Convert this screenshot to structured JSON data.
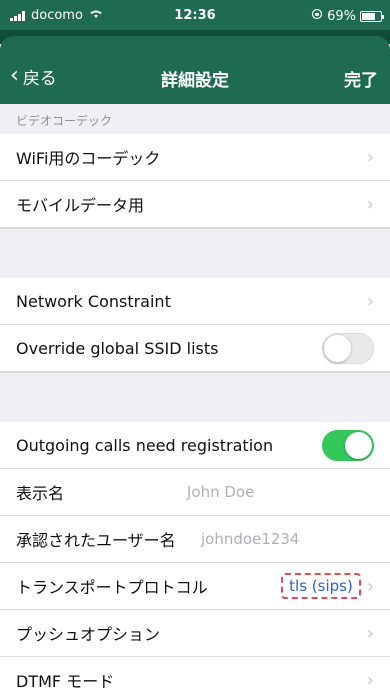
{
  "statusbar": {
    "carrier": "docomo",
    "time": "12:36",
    "battery": "69%"
  },
  "navbar": {
    "back_label": "戻る",
    "title": "詳細設定",
    "done_label": "完了"
  },
  "sections": {
    "video_codec_header": "ビデオコーデック",
    "wifi_codec": "WiFi用のコーデック",
    "mobile_data": "モバイルデータ用",
    "network_constraint": "Network Constraint",
    "override_ssid": "Override global SSID lists",
    "override_ssid_enabled": false,
    "outgoing_registration": "Outgoing calls need registration",
    "outgoing_registration_enabled": true,
    "display_name_label": "表示名",
    "display_name_placeholder": "John Doe",
    "auth_username_label": "承認されたユーザー名",
    "auth_username_placeholder": "johndoe1234",
    "transport_label": "トランスポートプロトコル",
    "transport_value": "tls (sips)",
    "push_options": "プッシュオプション",
    "dtmf_mode": "DTMF モード"
  },
  "colors": {
    "nav": "#1e6b52",
    "toggle_on": "#34c759",
    "highlight_border": "#e04e55",
    "value_text": "#2e63c8"
  }
}
